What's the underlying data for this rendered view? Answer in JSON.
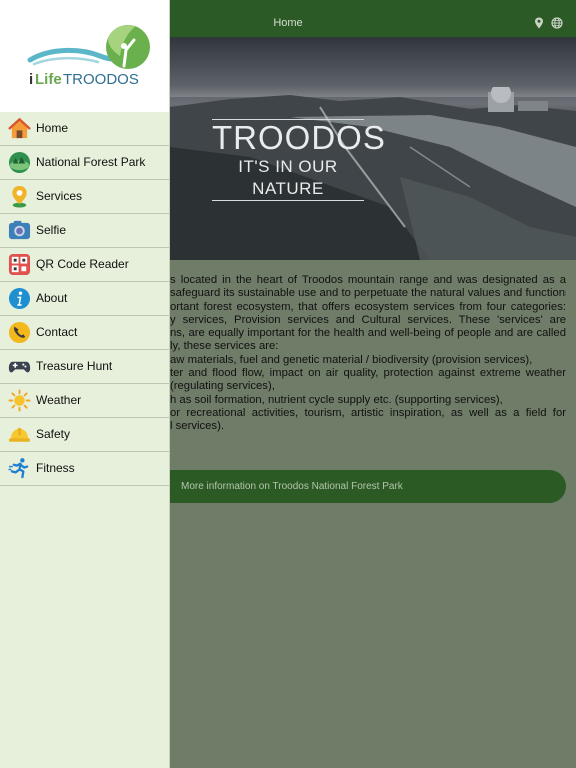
{
  "header": {
    "title": "Home",
    "location_icon": "map-pin-icon",
    "language_icon": "globe-icon"
  },
  "logo": {
    "text_i": "i",
    "text_life": "Life",
    "text_troodos": "TROODOS"
  },
  "hero": {
    "title": "TROODOS",
    "subtitle": "IT'S IN OUR NATURE",
    "slides": 6,
    "active_slide": 1
  },
  "menu": [
    {
      "label": "Home",
      "icon": "house-icon"
    },
    {
      "label": "National Forest Park",
      "icon": "forest-park-icon"
    },
    {
      "label": "Services",
      "icon": "location-pin-icon"
    },
    {
      "label": "Selfie",
      "icon": "camera-icon"
    },
    {
      "label": "QR Code Reader",
      "icon": "qr-code-icon"
    },
    {
      "label": "About",
      "icon": "info-icon"
    },
    {
      "label": "Contact",
      "icon": "phone-icon"
    },
    {
      "label": "Treasure Hunt",
      "icon": "gamepad-icon"
    },
    {
      "label": "Weather",
      "icon": "sun-icon"
    },
    {
      "label": "Safety",
      "icon": "hard-hat-icon"
    },
    {
      "label": "Fitness",
      "icon": "runner-icon"
    }
  ],
  "body_lines": [
    "s located in the heart of Troodos mountain range and was designated as a",
    "safeguard its sustainable use and to perpetuate the natural values and functions",
    "ortant forest ecosystem, that offers ecosystem services from four categories:",
    "y services, Provision services and Cultural services. These 'services' are",
    "ns, are equally important for the health and well-being of people and are called",
    "ly, these services are:",
    "aw materials, fuel and genetic material / biodiversity (provision services),",
    "ter and flood flow, impact on air quality, protection against extreme weather",
    "(regulating services),",
    "h as soil formation, nutrient cycle supply etc. (supporting services),",
    "or recreational activities, tourism, artistic inspiration, as well as a field for",
    "l services)."
  ],
  "more_button": {
    "label": "More information on Troodos National Forest Park"
  },
  "colors": {
    "primary": "#2c5a26",
    "drawer_bg": "#e6f0db",
    "overlay": "#6f7c68"
  }
}
